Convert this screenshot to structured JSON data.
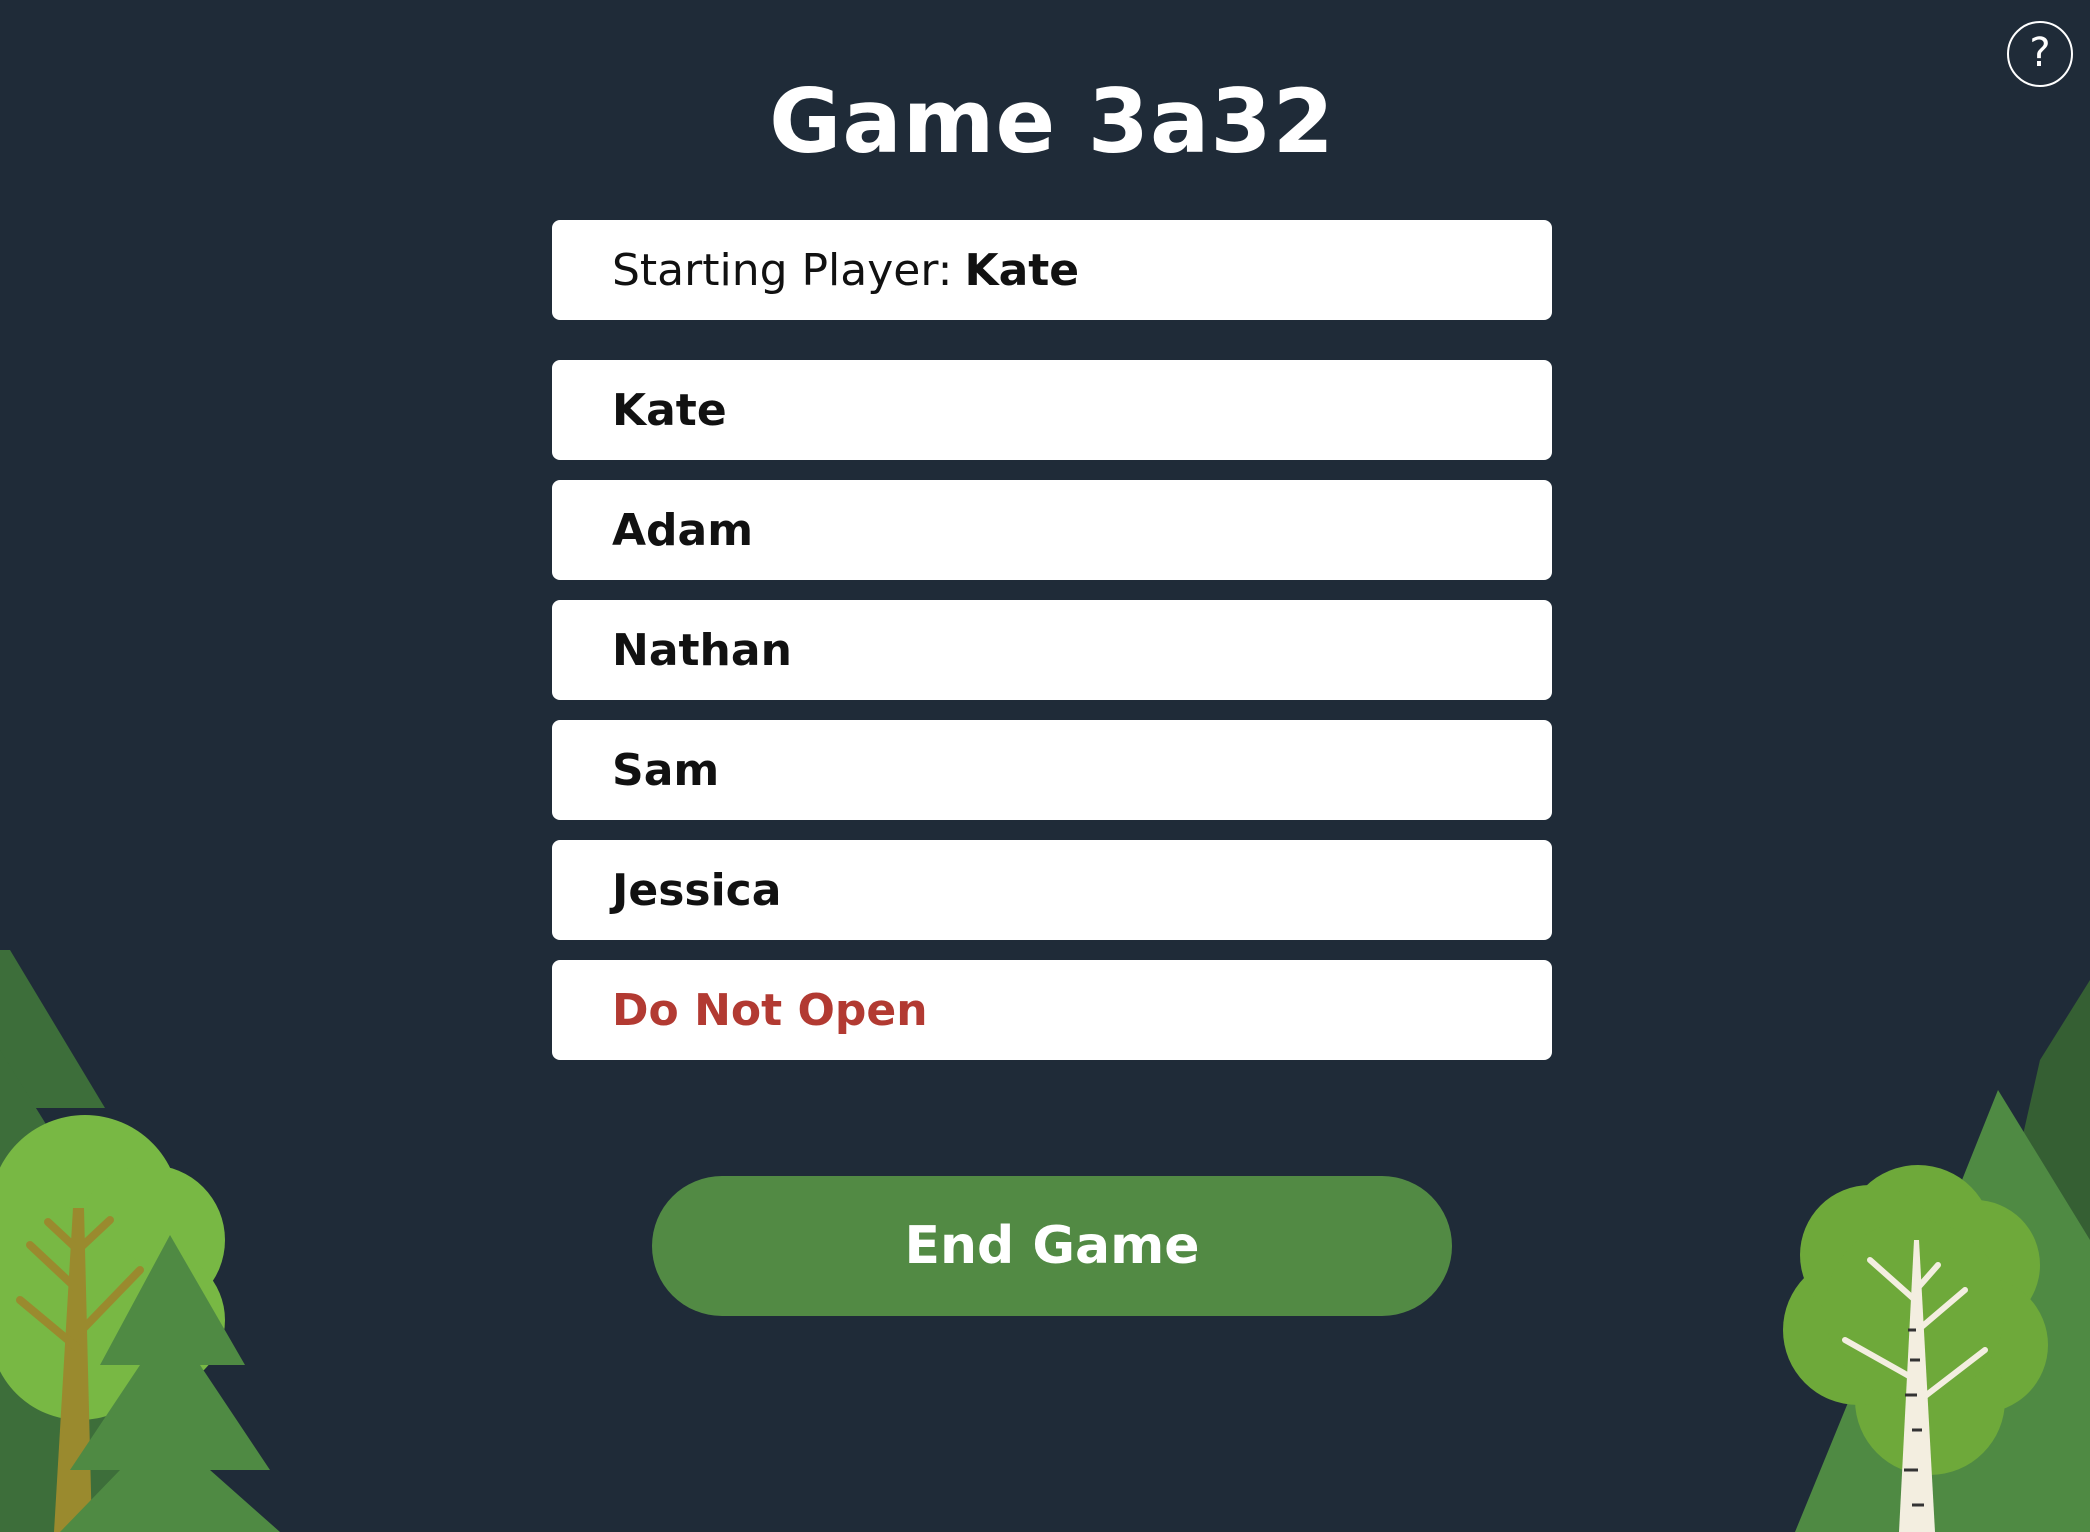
{
  "page": {
    "title": "Game 3a32",
    "help_label": "?"
  },
  "starting_player": {
    "label": "Starting Player:",
    "name": "Kate"
  },
  "players": [
    {
      "name": "Kate"
    },
    {
      "name": "Adam"
    },
    {
      "name": "Nathan"
    },
    {
      "name": "Sam"
    },
    {
      "name": "Jessica"
    }
  ],
  "warning_item": {
    "label": "Do Not Open",
    "color": "#b23a32"
  },
  "actions": {
    "end_game_label": "End Game"
  },
  "colors": {
    "background": "#1f2b38",
    "button": "#528a44",
    "card": "#ffffff"
  }
}
